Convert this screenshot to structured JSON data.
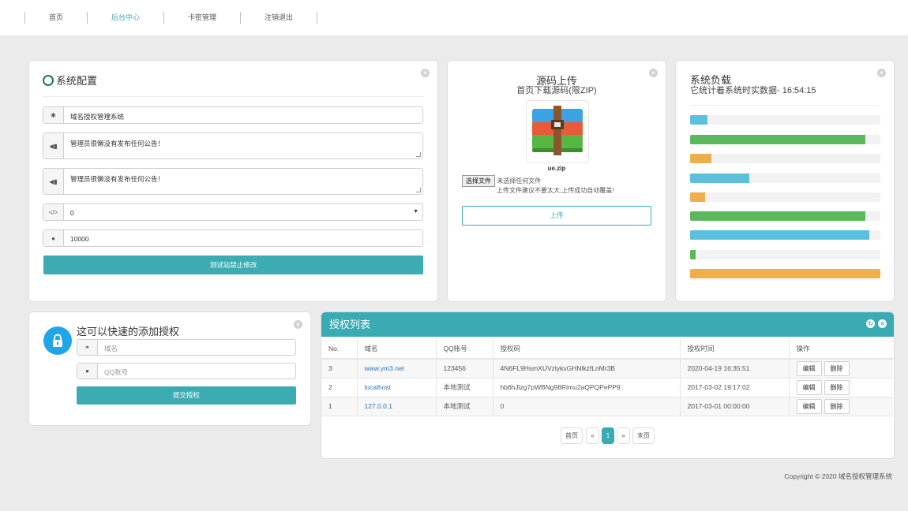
{
  "nav": {
    "items": [
      "首页",
      "后台中心",
      "卡密管理",
      "注销退出"
    ]
  },
  "config": {
    "title": "系统配置",
    "site_name": "域名授权管理系统",
    "notice1": "管理员很懒没有发布任何公告！",
    "notice2": "管理员很懒没有发布任何公告！",
    "select_value": "0",
    "qq": "10000",
    "submit_label": "测试站禁止修改"
  },
  "upload": {
    "title": "源码上传",
    "subtitle": "首页下载源码(限ZIP)",
    "file_name": "ue.zip",
    "choose_label": "选择文件",
    "no_file": "未选择任何文件",
    "hint": "上传文件建议不要太大,上传成功自动覆盖!",
    "upload_label": "上传"
  },
  "load": {
    "title": "系统负载",
    "subtitle": "它统计着系统时实数据- 16:54:15",
    "bars": [
      {
        "value": 0.09,
        "color": "#5bc0de"
      },
      {
        "value": 0.92,
        "color": "#5cb85c"
      },
      {
        "value": 0.11,
        "color": "#f0ad4e"
      },
      {
        "value": 0.31,
        "color": "#5bc0de"
      },
      {
        "value": 0.08,
        "color": "#f0ad4e"
      },
      {
        "value": 0.92,
        "color": "#5cb85c"
      },
      {
        "value": 0.94,
        "color": "#5bc0de"
      },
      {
        "value": 0.03,
        "color": "#5cb85c"
      },
      {
        "value": 1.0,
        "color": "#f0ad4e"
      }
    ]
  },
  "quick": {
    "title": "这可以快速的添加授权",
    "domain_placeholder": "域名",
    "qq_placeholder": "QQ账号",
    "submit_label": "提交授权"
  },
  "list": {
    "title": "授权列表",
    "columns": [
      "No.",
      "域名",
      "QQ账号",
      "授权码",
      "授权时间",
      "操作"
    ],
    "rows": [
      {
        "no": "3",
        "domain": "www.ym3.net",
        "qq": "123456",
        "code": "4N6FL9HsmXUVzlykxGHNlkzfLnMr3B",
        "time": "2020-04-19 16:35:51"
      },
      {
        "no": "2",
        "domain": "localhost",
        "qq": "本地测试",
        "code": "hb6hJlzg7pWBNg98Rimu2aQPQPePP9",
        "time": "2017-03-02 19:17:02"
      },
      {
        "no": "1",
        "domain": "127.0.0.1",
        "qq": "本地测试",
        "code": "0",
        "time": "2017-03-01 00:00:00"
      }
    ],
    "edit_label": "编辑",
    "delete_label": "删除",
    "pagination": {
      "first": "首页",
      "prev": "«",
      "current": "1",
      "next": "»",
      "last": "末页"
    }
  },
  "footer": "Copyright © 2020 域名授权管理系统",
  "colors": {
    "accent": "#3aaab3",
    "link": "#2a77b8"
  }
}
